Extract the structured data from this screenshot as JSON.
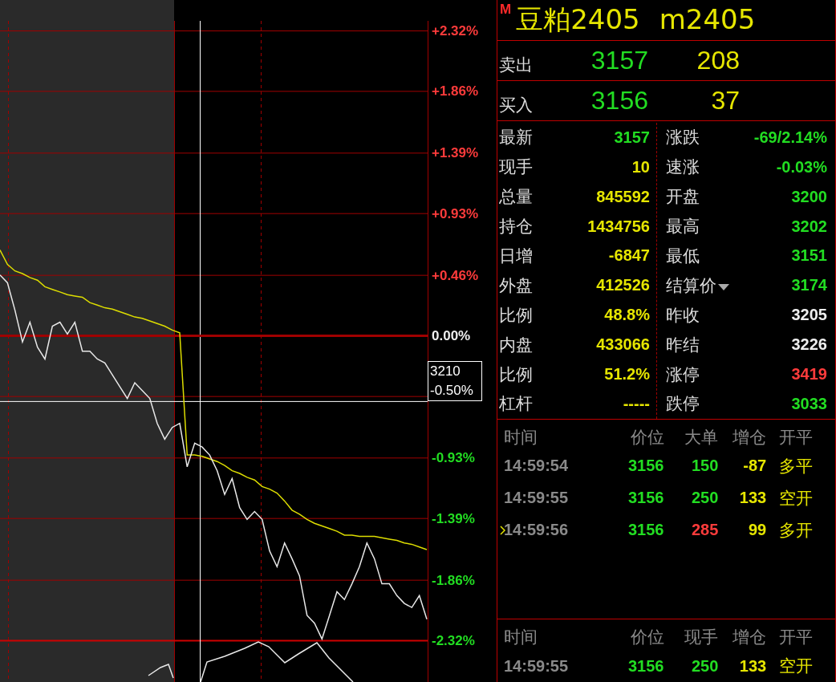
{
  "chart": {
    "chart_data": {
      "type": "line",
      "ylim": [
        -2.32,
        2.32
      ],
      "grid": true,
      "ref_lines": [
        {
          "axis": "y",
          "value": 0,
          "color": "#a00000"
        },
        {
          "axis": "y",
          "value": -0.5,
          "color": "#ffffff"
        }
      ],
      "yticks": [
        {
          "value": 2.32,
          "label": "+2.32%"
        },
        {
          "value": 1.86,
          "label": "+1.86%"
        },
        {
          "value": 1.39,
          "label": "+1.39%"
        },
        {
          "value": 0.93,
          "label": "+0.93%"
        },
        {
          "value": 0.46,
          "label": "+0.46%"
        },
        {
          "value": 0,
          "label": "0.00%"
        },
        {
          "value": -0.93,
          "label": "-0.93%"
        },
        {
          "value": -1.39,
          "label": "-1.39%"
        },
        {
          "value": -1.86,
          "label": "-1.86%"
        },
        {
          "value": -2.32,
          "label": "-2.32%"
        }
      ],
      "series": [
        {
          "color": "#e8e8e8",
          "values": [
            0.46,
            0.4,
            0.19,
            -0.05,
            0.1,
            -0.09,
            -0.18,
            0.07,
            0.1,
            0.01,
            0.1,
            -0.12,
            -0.12,
            -0.18,
            -0.21,
            -0.3,
            -0.39,
            -0.48,
            -0.36,
            -0.42,
            -0.48,
            -0.67,
            -0.79,
            -0.7,
            -0.67,
            -1.0,
            -0.82,
            -0.85,
            -0.91,
            -1.03,
            -1.21,
            -1.09,
            -1.31,
            -1.4,
            -1.34,
            -1.4,
            -1.64,
            -1.76,
            -1.58,
            -1.7,
            -1.83,
            -2.13,
            -2.19,
            -2.31,
            -2.13,
            -1.95,
            -2.01,
            -1.89,
            -1.76,
            -1.58,
            -1.7,
            -1.89,
            -1.89,
            -1.98,
            -2.04,
            -2.07,
            -1.98,
            -2.16
          ]
        },
        {
          "color": "#dddd00",
          "values": [
            0.65,
            0.54,
            0.49,
            0.47,
            0.44,
            0.42,
            0.37,
            0.35,
            0.33,
            0.31,
            0.3,
            0.29,
            0.25,
            0.23,
            0.21,
            0.2,
            0.18,
            0.16,
            0.14,
            0.13,
            0.11,
            0.09,
            0.07,
            0.04,
            0.02,
            -0.91,
            -0.91,
            -0.92,
            -0.94,
            -0.96,
            -0.99,
            -1.03,
            -1.05,
            -1.08,
            -1.1,
            -1.15,
            -1.17,
            -1.2,
            -1.26,
            -1.33,
            -1.36,
            -1.4,
            -1.43,
            -1.45,
            -1.47,
            -1.49,
            -1.52,
            -1.52,
            -1.53,
            -1.53,
            -1.53,
            -1.54,
            -1.55,
            -1.56,
            -1.58,
            -1.59,
            -1.61,
            -1.63
          ]
        }
      ]
    },
    "crosshair": {
      "price": "3210",
      "change": "-0.50%"
    }
  },
  "header": {
    "badge": "M",
    "name": "豆粕2405",
    "code": "m2405"
  },
  "quote": [
    {
      "label": "卖出",
      "price": "3157",
      "volume": "208"
    },
    {
      "label": "买入",
      "price": "3156",
      "volume": "37"
    }
  ],
  "stats_left": [
    {
      "label": "最新",
      "value": "3157",
      "color": "#22dd22"
    },
    {
      "label": "现手",
      "value": "10",
      "color": "#e6e600"
    },
    {
      "label": "总量",
      "value": "845592",
      "color": "#e6e600"
    },
    {
      "label": "持仓",
      "value": "1434756",
      "color": "#e6e600"
    },
    {
      "label": "日增",
      "value": "-6847",
      "color": "#e6e600"
    },
    {
      "label": "外盘",
      "value": "412526",
      "color": "#e6e600"
    },
    {
      "label": "比例",
      "value": "48.8%",
      "color": "#e6e600"
    },
    {
      "label": "内盘",
      "value": "433066",
      "color": "#e6e600"
    },
    {
      "label": "比例",
      "value": "51.2%",
      "color": "#e6e600"
    },
    {
      "label": "杠杆",
      "value": "-----",
      "color": "#e6e600"
    }
  ],
  "stats_right": [
    {
      "label": "涨跌",
      "value": "-69/2.14%",
      "color": "#22dd22",
      "kind": "plain"
    },
    {
      "label": "速涨",
      "value": "-0.03%",
      "color": "#22dd22",
      "kind": "plain"
    },
    {
      "label": "开盘",
      "value": "3200",
      "color": "#22dd22",
      "kind": "plain"
    },
    {
      "label": "最高",
      "value": "3202",
      "color": "#22dd22",
      "kind": "plain"
    },
    {
      "label": "最低",
      "value": "3151",
      "color": "#22dd22",
      "kind": "plain"
    },
    {
      "label": "结算价",
      "value": "3174",
      "color": "#22dd22",
      "kind": "menu"
    },
    {
      "label": "昨收",
      "value": "3205",
      "color": "#eeeeee",
      "kind": "plain"
    },
    {
      "label": "昨结",
      "value": "3226",
      "color": "#eeeeee",
      "kind": "plain"
    },
    {
      "label": "涨停",
      "value": "3419",
      "color": "#ff3b3b",
      "kind": "plain"
    },
    {
      "label": "跌停",
      "value": "3033",
      "color": "#22dd22",
      "kind": "plain"
    }
  ],
  "big_orders": {
    "columns": [
      "时间",
      "价位",
      "大单",
      "增仓",
      "开平"
    ],
    "rows": [
      {
        "selected": false,
        "cells": [
          {
            "text": "14:59:54",
            "color": "#8a8a8a"
          },
          {
            "text": "3156",
            "color": "#22dd22"
          },
          {
            "text": "150",
            "color": "#22dd22"
          },
          {
            "text": "-87",
            "color": "#e6e600"
          },
          {
            "text": "多平",
            "color": "#e6e600"
          }
        ]
      },
      {
        "selected": false,
        "cells": [
          {
            "text": "14:59:55",
            "color": "#8a8a8a"
          },
          {
            "text": "3156",
            "color": "#22dd22"
          },
          {
            "text": "250",
            "color": "#22dd22"
          },
          {
            "text": "133",
            "color": "#e6e600"
          },
          {
            "text": "空开",
            "color": "#e6e600"
          }
        ]
      },
      {
        "selected": true,
        "cells": [
          {
            "text": "14:59:56",
            "color": "#8a8a8a"
          },
          {
            "text": "3156",
            "color": "#22dd22"
          },
          {
            "text": "285",
            "color": "#ff3b3b"
          },
          {
            "text": "99",
            "color": "#e6e600"
          },
          {
            "text": "多开",
            "color": "#e6e600"
          }
        ]
      }
    ]
  },
  "ticks": {
    "columns": [
      "时间",
      "价位",
      "现手",
      "增仓",
      "开平"
    ],
    "rows": [
      {
        "selected": false,
        "cells": [
          {
            "text": "14:59:55",
            "color": "#8a8a8a"
          },
          {
            "text": "3156",
            "color": "#22dd22"
          },
          {
            "text": "250",
            "color": "#22dd22"
          },
          {
            "text": "133",
            "color": "#e6e600"
          },
          {
            "text": "空开",
            "color": "#e6e600"
          }
        ]
      }
    ]
  }
}
